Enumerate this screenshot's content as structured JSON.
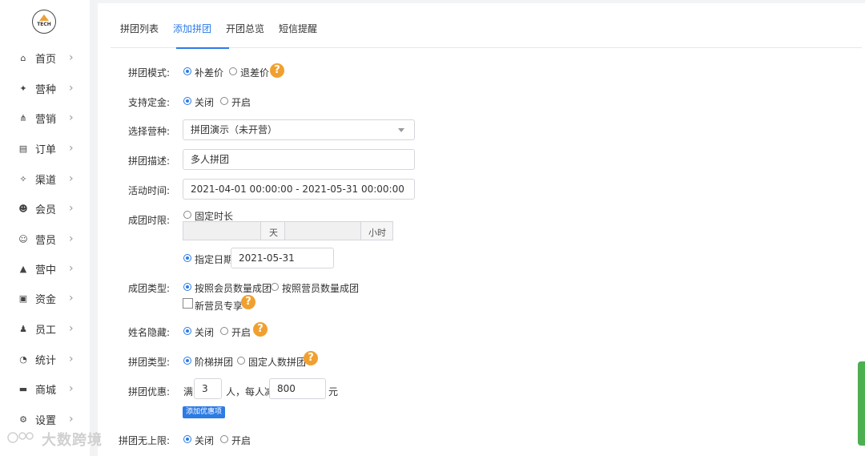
{
  "logo": {
    "text": "TECH"
  },
  "sidebar": {
    "items": [
      {
        "label": "首页",
        "icon": "home-icon",
        "glyph": "⌂"
      },
      {
        "label": "营种",
        "icon": "graduation-cap-icon",
        "glyph": "✦"
      },
      {
        "label": "营销",
        "icon": "sitemap-icon",
        "glyph": "⋔"
      },
      {
        "label": "订单",
        "icon": "clipboard-icon",
        "glyph": "▤"
      },
      {
        "label": "渠道",
        "icon": "handshake-icon",
        "glyph": "✧"
      },
      {
        "label": "会员",
        "icon": "user-group-icon",
        "glyph": "☻"
      },
      {
        "label": "营员",
        "icon": "camper-icon",
        "glyph": "☺"
      },
      {
        "label": "营中",
        "icon": "tent-icon",
        "glyph": "▲"
      },
      {
        "label": "资金",
        "icon": "money-icon",
        "glyph": "▣"
      },
      {
        "label": "员工",
        "icon": "staff-icon",
        "glyph": "♟"
      },
      {
        "label": "统计",
        "icon": "pie-chart-icon",
        "glyph": "◔"
      },
      {
        "label": "商城",
        "icon": "shop-icon",
        "glyph": "▬"
      },
      {
        "label": "设置",
        "icon": "gear-icon",
        "glyph": "⚙"
      }
    ],
    "chevron": "›"
  },
  "tabs": [
    {
      "label": "拼团列表",
      "active": false
    },
    {
      "label": "添加拼团",
      "active": true
    },
    {
      "label": "开团总览",
      "active": false
    },
    {
      "label": "短信提醒",
      "active": false
    }
  ],
  "form": {
    "mode": {
      "label": "拼团模式:",
      "options": [
        "补差价",
        "退差价"
      ],
      "selected": 0
    },
    "deposit": {
      "label": "支持定金:",
      "options": [
        "关闭",
        "开启"
      ],
      "selected": 0
    },
    "camp": {
      "label": "选择营种:",
      "value": "拼团演示（未开营）"
    },
    "desc": {
      "label": "拼团描述:",
      "value": "多人拼团"
    },
    "time": {
      "label": "活动时间:",
      "value": "2021-04-01 00:00:00 - 2021-05-31 00:00:00"
    },
    "limit": {
      "label": "成团时限:",
      "fixed_label": "固定时长",
      "day_unit": "天",
      "hour_unit": "小时",
      "date_label": "指定日期",
      "date_value": "2021-05-31",
      "selected": "date"
    },
    "group_type": {
      "label": "成团类型:",
      "options": [
        "按照会员数量成团",
        "按照营员数量成团"
      ],
      "selected": 0,
      "new_only": "新营员专享"
    },
    "hide_name": {
      "label": "姓名隐藏:",
      "options": [
        "关闭",
        "开启"
      ],
      "selected": 0
    },
    "pt_type": {
      "label": "拼团类型:",
      "options": [
        "阶梯拼团",
        "固定人数拼团"
      ],
      "selected": 0
    },
    "discount": {
      "label": "拼团优惠:",
      "prefix": "满",
      "count": "3",
      "mid": "人，每人减",
      "amount": "800",
      "suffix": "元",
      "add_button": "添加优惠项"
    },
    "unlimited": {
      "label": "拼团无上限:",
      "options": [
        "关闭",
        "开启"
      ],
      "selected": 0
    }
  },
  "help_glyph": "?",
  "watermark": "大数跨境",
  "colors": {
    "accent": "#2d7be5",
    "help": "#f0a030",
    "side_tab": "#4caf50"
  }
}
